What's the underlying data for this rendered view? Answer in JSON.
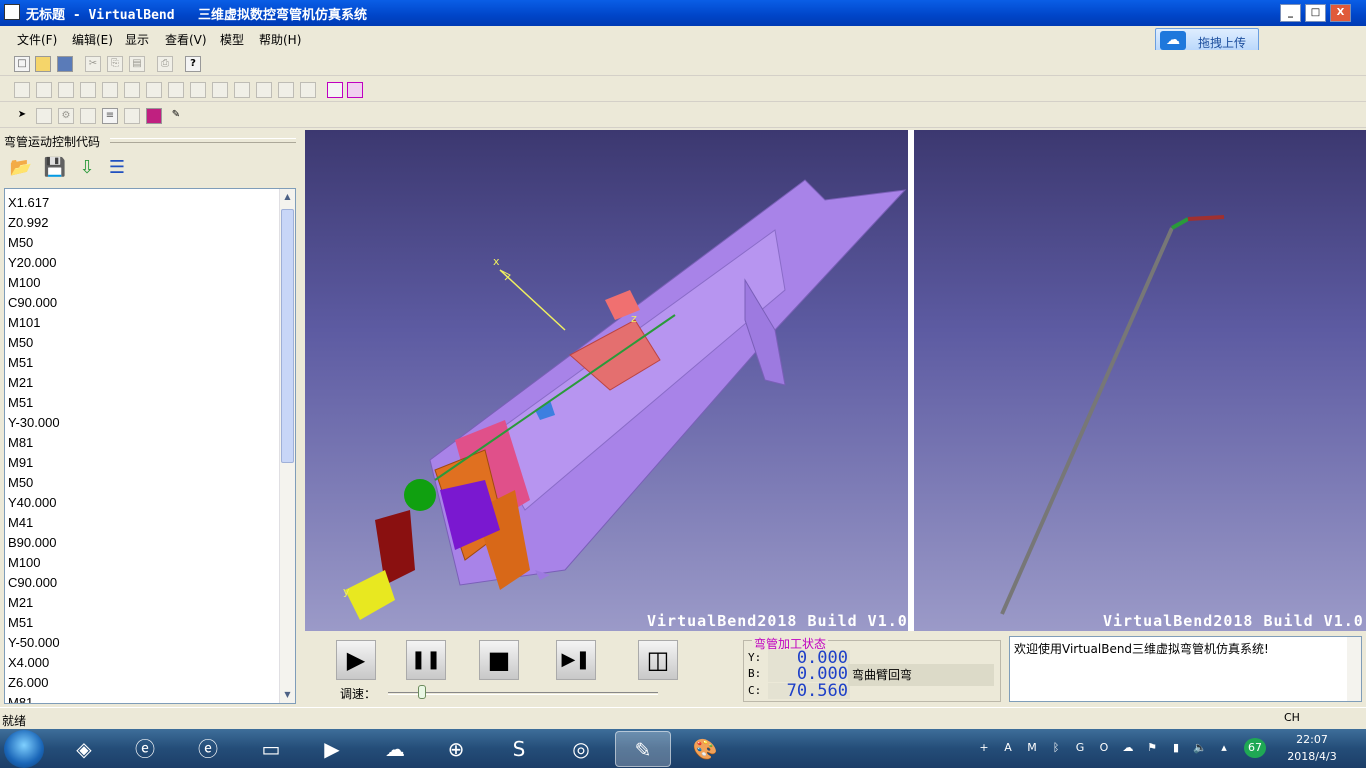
{
  "window": {
    "title": "无标题 - VirtualBend   三维虚拟数控弯管机仿真系统",
    "min": "_",
    "max": "□",
    "close": "X"
  },
  "menu": [
    "文件(F)",
    "编辑(E)",
    "显示",
    "查看(V)",
    "模型",
    "帮助(H)"
  ],
  "upload": {
    "label": "拖拽上传"
  },
  "left_panel": {
    "title": "弯管运动控制代码",
    "code": [
      "X1.617",
      "Z0.992",
      "M50",
      "Y20.000",
      "M100",
      "C90.000",
      "M101",
      "M50",
      "M51",
      "M21",
      "M51",
      "Y-30.000",
      "M81",
      "M91",
      "M50",
      "Y40.000",
      "M41",
      "B90.000",
      "M100",
      "C90.000",
      "M21",
      "M51",
      "Y-50.000",
      "X4.000",
      "Z6.000",
      "M81"
    ]
  },
  "viewport_left": {
    "watermark": "VirtualBend2018 Build V1.0",
    "axis_x": "x",
    "axis_y": "y",
    "axis_z": "z"
  },
  "viewport_right": {
    "watermark": "VirtualBend2018 Build V1.0"
  },
  "controls": {
    "play": "▶",
    "pause": "❚❚",
    "stop": "■",
    "next": "▶❚",
    "split": "◫",
    "speed_label": "调速："
  },
  "bend_status": {
    "title": "弯管加工状态",
    "y_label": "Y:",
    "y_value": "0.000",
    "b_label": "B:",
    "b_value": "0.000",
    "c_label": "C:",
    "c_value": "70.560",
    "mode": "弯曲臂回弯"
  },
  "message": "欢迎使用VirtualBend三维虚拟弯管机仿真系统!",
  "statusbar": {
    "ready": "就绪",
    "ime": "CH"
  },
  "taskbar": {
    "time": "22:07",
    "date": "2018/4/3",
    "badge": "67"
  }
}
